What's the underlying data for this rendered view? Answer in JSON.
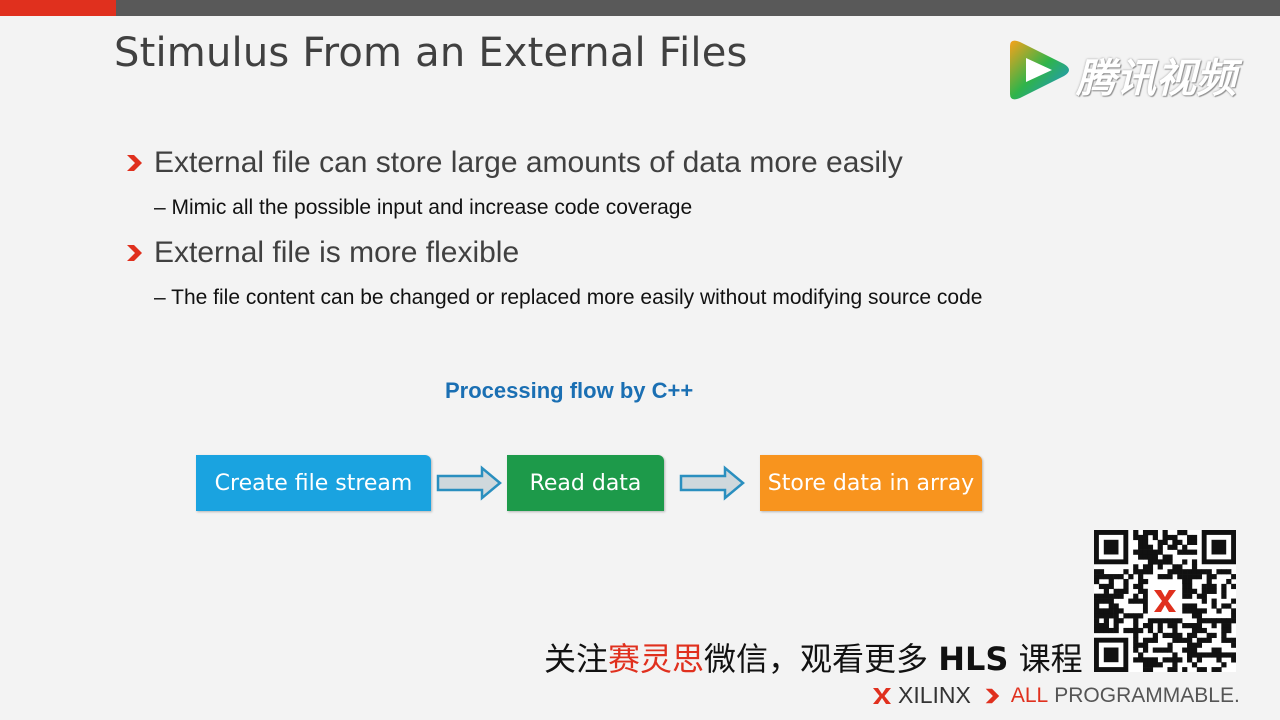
{
  "slide": {
    "title": "Stimulus From an External Files",
    "bullets": [
      {
        "text": "External file can store large amounts of data more easily",
        "sub": "– Mimic all the possible input and increase code coverage"
      },
      {
        "text": "External file is more flexible",
        "sub": "– The file content can be changed or replaced more easily without modifying source code"
      }
    ]
  },
  "watermark": {
    "text": "腾讯视频",
    "icon": "tencent-video-play-icon"
  },
  "flow": {
    "title": "Processing flow by C++",
    "steps": [
      "Create file stream",
      "Read data",
      "Store data in array"
    ],
    "colors": [
      "#1aa3e0",
      "#1d9a4a",
      "#f8941e"
    ]
  },
  "promo": {
    "prefix": "关注",
    "highlight": "赛灵思",
    "middle": "微信，观看更多 ",
    "bold": "HLS",
    "suffix": " 课程"
  },
  "footer": {
    "brand": "XILINX",
    "tagline_all": "ALL",
    "tagline_rest": "PROGRAMMABLE."
  },
  "colors": {
    "accent": "#e0301e",
    "topbar": "#595959",
    "flow_title": "#1a6fb3"
  }
}
